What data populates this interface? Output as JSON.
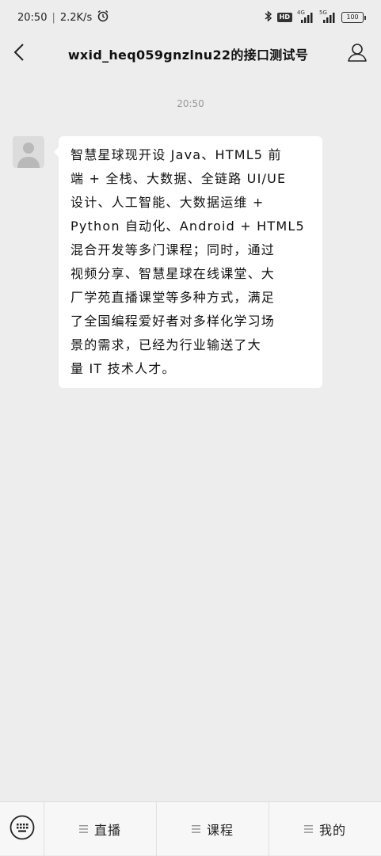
{
  "status_bar": {
    "time": "20:50",
    "net_speed": "2.2K/s",
    "hd_label": "HD",
    "sig1_tag": "4G",
    "sig2_tag": "5G",
    "battery": "100"
  },
  "header": {
    "title": "wxid_heq059gnzlnu22的接口测试号"
  },
  "chat": {
    "timestamp": "20:50",
    "message_lines": [
      "智慧星球现开设 Java、HTML5 前",
      "端 + 全栈、大数据、全链路 UI/UE",
      "设计、人工智能、大数据运维 +",
      "Python 自动化、Android + HTML5",
      "混合开发等多门课程；同时，通过",
      "视频分享、智慧星球在线课堂、大",
      "厂学苑直播课堂等多种方式，满足",
      "了全国编程爱好者对多样化学习场",
      "景的需求，已经为行业输送了大",
      "量 IT 技术人才。"
    ]
  },
  "bottom_menu": [
    {
      "label": "直播"
    },
    {
      "label": "课程"
    },
    {
      "label": "我的"
    }
  ]
}
